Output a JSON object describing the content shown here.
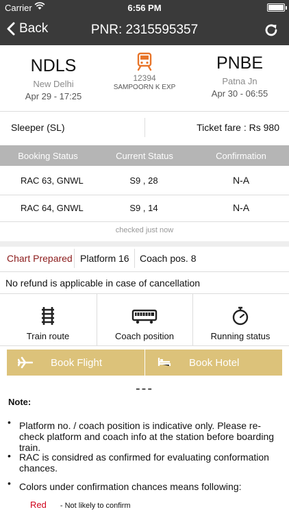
{
  "status_bar": {
    "carrier": "Carrier",
    "time": "6:56 PM"
  },
  "nav": {
    "back_label": "Back",
    "title": "PNR: 2315595357"
  },
  "journey": {
    "from_code": "NDLS",
    "from_name": "New Delhi",
    "from_datetime": "Apr 29 - 17:25",
    "train_number": "12394",
    "train_name": "SAMPOORN K EXP",
    "to_code": "PNBE",
    "to_name": "Patna Jn",
    "to_datetime": "Apr 30 - 06:55"
  },
  "ticket": {
    "class": "Sleeper (SL)",
    "fare": "Ticket fare : Rs 980"
  },
  "status_table": {
    "headers": [
      "Booking Status",
      "Current Status",
      "Confirmation"
    ],
    "rows": [
      [
        "RAC 63, GNWL",
        "S9 , 28",
        "N-A"
      ],
      [
        "RAC 64, GNWL",
        "S9 , 14",
        "N-A"
      ]
    ],
    "checked": "checked just now"
  },
  "chart": {
    "status": "Chart Prepared",
    "platform": "Platform 16",
    "coach_pos": "Coach pos. 8"
  },
  "refund_note": "No refund is applicable in case of cancellation",
  "actions": {
    "train_route": "Train route",
    "coach_position": "Coach position",
    "running_status": "Running status"
  },
  "booking": {
    "flight": "Book Flight",
    "hotel": "Book Hotel"
  },
  "separator": "---",
  "notes": {
    "title": "Note:",
    "bullet": "•",
    "items": [
      "Platform no. / coach position is indicative only. Please re-check platform and coach info at the station before boarding train.",
      "RAC is considred as confirmed for evaluating conformation chances.",
      "Colors under confirmation chances means following:"
    ],
    "legend": {
      "color_name": "Red",
      "meaning": "- Not likely to confirm"
    }
  },
  "colors": {
    "header_bg": "#3a3a3a",
    "accent": "#e8752a",
    "chart_text": "#8b1a1a",
    "book_bar": "#dcc27a",
    "legend_red": "#d0021b"
  }
}
